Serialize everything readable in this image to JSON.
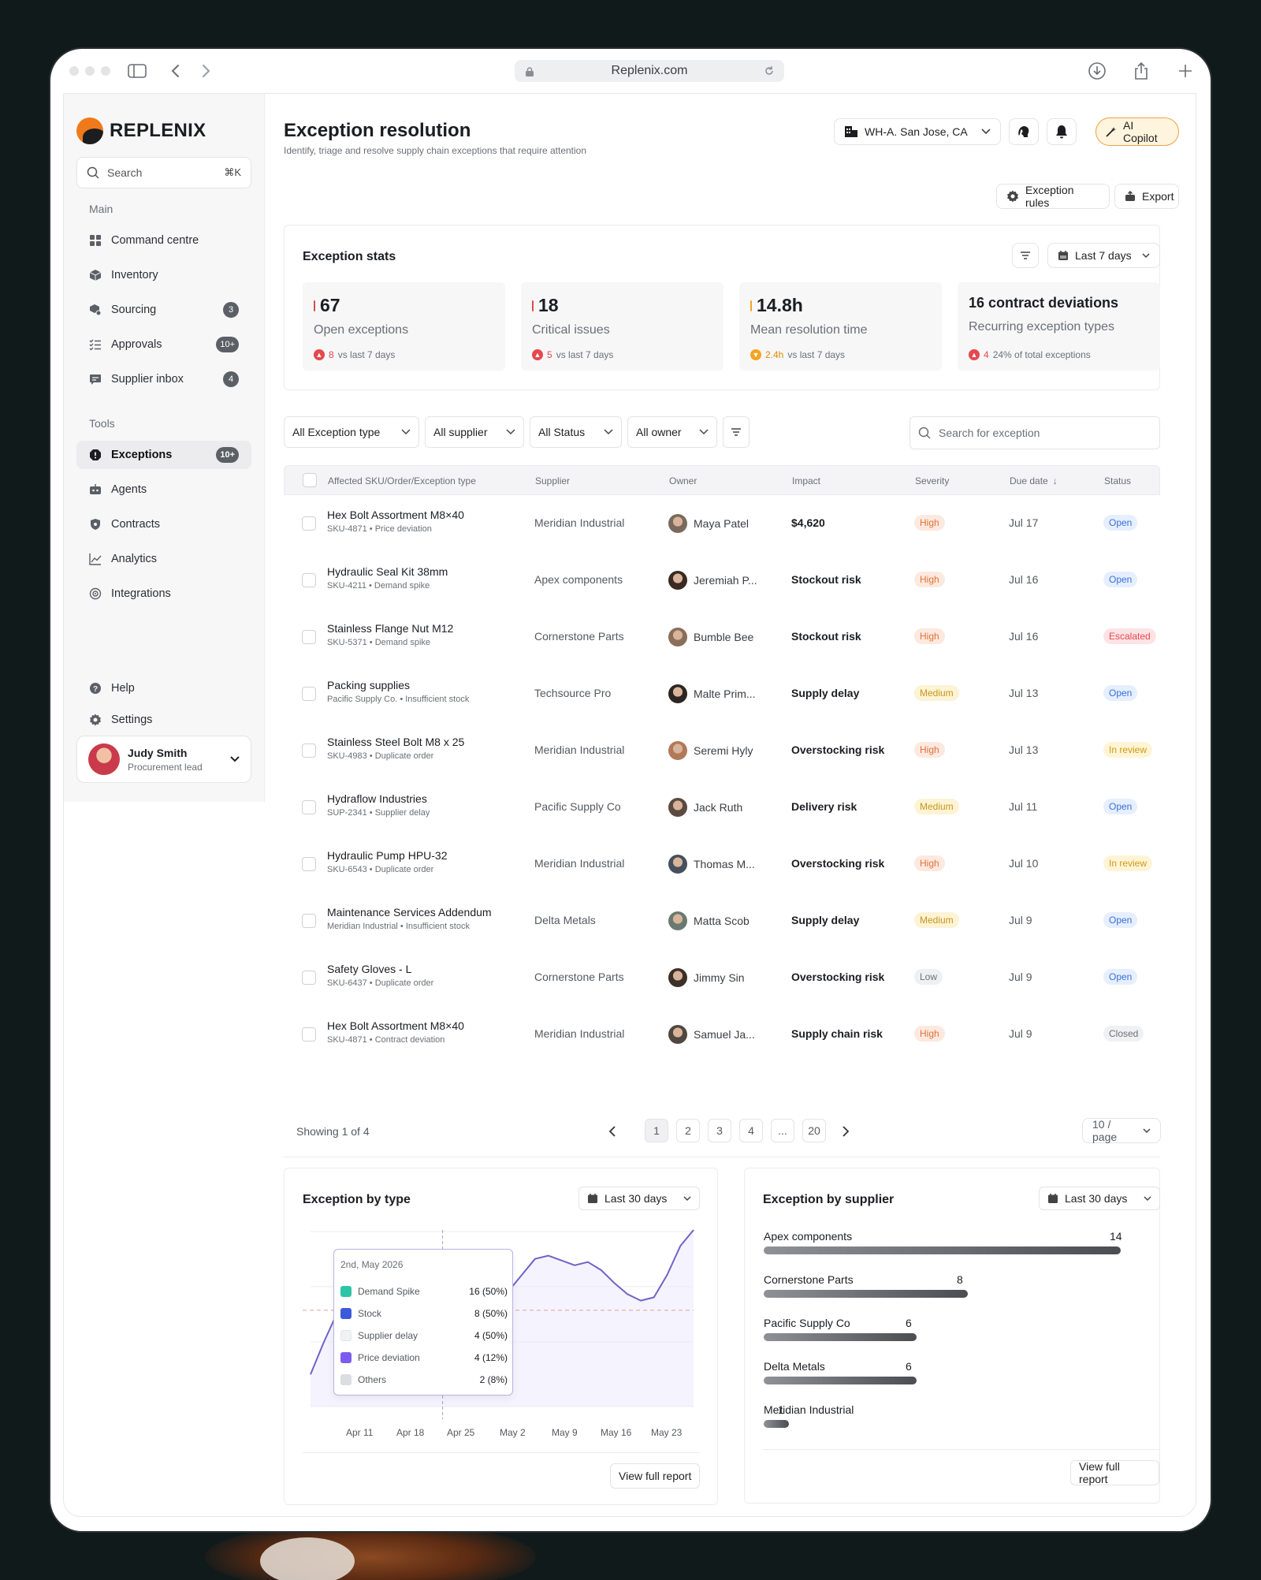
{
  "browser": {
    "url": "Replenix.com"
  },
  "brand": {
    "name": "REPLENIX",
    "accent": "#f07a1a"
  },
  "sidebar": {
    "search_placeholder": "Search",
    "search_shortcut": "⌘K",
    "main_label": "Main",
    "main_items": [
      {
        "label": "Command centre",
        "icon": "grid-icon",
        "badge": ""
      },
      {
        "label": "Inventory",
        "icon": "box-icon",
        "badge": ""
      },
      {
        "label": "Sourcing",
        "icon": "sourcing-icon",
        "badge": "3"
      },
      {
        "label": "Approvals",
        "icon": "checklist-icon",
        "badge": "10+"
      },
      {
        "label": "Supplier inbox",
        "icon": "chat-icon",
        "badge": "4"
      }
    ],
    "tools_label": "Tools",
    "tools_items": [
      {
        "label": "Exceptions",
        "icon": "alert-icon",
        "badge": "10+"
      },
      {
        "label": "Agents",
        "icon": "robot-icon",
        "badge": ""
      },
      {
        "label": "Contracts",
        "icon": "shield-icon",
        "badge": ""
      },
      {
        "label": "Analytics",
        "icon": "chart-line-icon",
        "badge": ""
      },
      {
        "label": "Integrations",
        "icon": "gear-cog-icon",
        "badge": ""
      }
    ],
    "help": "Help",
    "settings": "Settings",
    "user": {
      "name": "Judy Smith",
      "role": "Procurement lead"
    }
  },
  "header": {
    "title": "Exception resolution",
    "subtitle": "Identify, triage and resolve supply chain exceptions that require attention",
    "warehouse": "WH-A. San Jose, CA",
    "copilot": "AI Copilot",
    "exception_rules": "Exception rules",
    "export": "Export"
  },
  "stats": {
    "title": "Exception stats",
    "period": "Last 7 days",
    "cards": [
      {
        "value": "67",
        "label": "Open exceptions",
        "delta": "8",
        "delta_text": "vs last 7 days",
        "bar_color": "#e5484d",
        "icon_color": "#e5484d"
      },
      {
        "value": "18",
        "label": "Critical issues",
        "delta": "5",
        "delta_text": "vs last 7 days",
        "bar_color": "#e5484d",
        "icon_color": "#e5484d"
      },
      {
        "value": "14.8h",
        "label": "Mean resolution time",
        "delta": "2.4h",
        "delta_text": "vs last 7 days",
        "bar_color": "#f5a524",
        "icon_color": "#f5a524"
      },
      {
        "value": "16 contract deviations",
        "label": "Recurring exception types",
        "delta": "4",
        "delta_text": "24% of total exceptions",
        "bar_color": "",
        "icon_color": "#e5484d"
      }
    ]
  },
  "filters": {
    "type": "All Exception type",
    "supplier": "All supplier",
    "status": "All Status",
    "owner": "All owner",
    "search_placeholder": "Search for exception"
  },
  "table": {
    "headers": {
      "item": "Affected SKU/Order/Exception type",
      "supplier": "Supplier",
      "owner": "Owner",
      "impact": "Impact",
      "severity": "Severity",
      "due": "Due date",
      "status": "Status"
    },
    "rows": [
      {
        "name": "Hex Bolt Assortment M8×40",
        "sub": "SKU-4871 • Price deviation",
        "supplier": "Meridian Industrial",
        "owner": "Maya Patel",
        "impact": "$4,620",
        "severity": "High",
        "due": "Jul 17",
        "status": "Open"
      },
      {
        "name": "Hydraulic Seal Kit 38mm",
        "sub": "SKU-4211 • Demand spike",
        "supplier": "Apex components",
        "owner": "Jeremiah P...",
        "impact": "Stockout risk",
        "severity": "High",
        "due": "Jul 16",
        "status": "Open"
      },
      {
        "name": "Stainless Flange Nut M12",
        "sub": "SKU-5371 • Demand spike",
        "supplier": "Cornerstone Parts",
        "owner": "Bumble Bee",
        "impact": "Stockout risk",
        "severity": "High",
        "due": "Jul 16",
        "status": "Escalated"
      },
      {
        "name": "Packing supplies",
        "sub": "Pacific Supply Co. • Insufficient stock",
        "supplier": "Techsource Pro",
        "owner": "Malte Prim...",
        "impact": "Supply delay",
        "severity": "Medium",
        "due": "Jul 13",
        "status": "Open"
      },
      {
        "name": "Stainless Steel Bolt M8 x 25",
        "sub": "SKU-4983 • Duplicate order",
        "supplier": "Meridian Industrial",
        "owner": "Seremi Hyly",
        "impact": "Overstocking risk",
        "severity": "High",
        "due": "Jul 13",
        "status": "In review"
      },
      {
        "name": "Hydraflow Industries",
        "sub": "SUP-2341 • Supplier delay",
        "supplier": "Pacific Supply Co",
        "owner": "Jack Ruth",
        "impact": "Delivery risk",
        "severity": "Medium",
        "due": "Jul 11",
        "status": "Open"
      },
      {
        "name": "Hydraulic Pump HPU-32",
        "sub": "SKU-6543 • Duplicate order",
        "supplier": "Meridian Industrial",
        "owner": "Thomas M...",
        "impact": "Overstocking risk",
        "severity": "High",
        "due": "Jul 10",
        "status": "In review"
      },
      {
        "name": "Maintenance Services Addendum",
        "sub": "Meridian Industrial • Insufficient stock",
        "supplier": "Delta Metals",
        "owner": "Matta Scob",
        "impact": "Supply delay",
        "severity": "Medium",
        "due": "Jul 9",
        "status": "Open"
      },
      {
        "name": "Safety Gloves - L",
        "sub": "SKU-6437 • Duplicate order",
        "supplier": "Cornerstone Parts",
        "owner": "Jimmy Sin",
        "impact": "Overstocking risk",
        "severity": "Low",
        "due": "Jul 9",
        "status": "Open"
      },
      {
        "name": "Hex Bolt Assortment M8×40",
        "sub": "SKU-4871 • Contract deviation",
        "supplier": "Meridian Industrial",
        "owner": "Samuel Ja...",
        "impact": "Supply chain risk",
        "severity": "High",
        "due": "Jul 9",
        "status": "Closed"
      }
    ],
    "showing": "Showing 1 of 4",
    "pages": [
      "1",
      "2",
      "3",
      "4",
      "...",
      "20"
    ],
    "per_page": "10 / page"
  },
  "by_type": {
    "title": "Exception by type",
    "period": "Last 30 days",
    "tooltip_date": "2nd, May 2026",
    "tooltip_items": [
      {
        "name": "Demand Spike",
        "value": "16 (50%)",
        "color": "#2ec4a7"
      },
      {
        "name": "Stock",
        "value": "8 (50%)",
        "color": "#3b5bdb"
      },
      {
        "name": "Supplier delay",
        "value": "4 (50%)",
        "color": "#f1f2f4"
      },
      {
        "name": "Price deviation",
        "value": "4 (12%)",
        "color": "#7c5cf0"
      },
      {
        "name": "Others",
        "value": "2 (8%)",
        "color": "#dcdde2"
      }
    ],
    "x_ticks": [
      "Apr 11",
      "Apr 18",
      "Apr 25",
      "May 2",
      "May 9",
      "May 16",
      "May 23"
    ],
    "button": "View full report"
  },
  "chart_data": {
    "type": "line",
    "title": "Exception by type",
    "x": [
      "Apr 11",
      "Apr 18",
      "Apr 25",
      "May 2",
      "May 9",
      "May 16",
      "May 23"
    ],
    "series": [
      {
        "values": [
          20,
          40,
          58,
          64,
          74,
          78,
          76,
          70,
          61,
          57,
          60,
          55,
          57,
          61,
          67,
          72,
          82,
          92,
          94,
          91,
          88,
          90,
          85,
          77,
          70,
          66,
          68,
          82,
          100,
          110
        ]
      }
    ],
    "tooltip_x": "May 2"
  },
  "by_supplier": {
    "title": "Exception by supplier",
    "period": "Last 30 days",
    "items": [
      {
        "name": "Apex components",
        "value": 14
      },
      {
        "name": "Cornerstone Parts",
        "value": 8
      },
      {
        "name": "Pacific Supply Co",
        "value": 6
      },
      {
        "name": "Delta Metals",
        "value": 6
      },
      {
        "name": "Meridian Industrial",
        "value": 1
      }
    ],
    "button": "View full report"
  }
}
